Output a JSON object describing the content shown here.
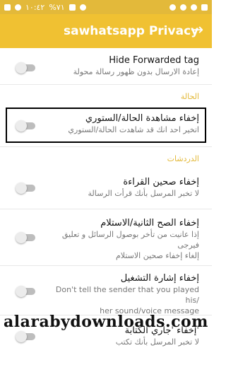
{
  "status_bar": {
    "time": "١٠:٤٢",
    "battery": "%٧١",
    "icons": [
      "sim-icon",
      "signal-icon",
      "wifi-icon",
      "battery-icon",
      "whatsapp-icon",
      "gear-icon",
      "circle-icon",
      "no-sim-icon"
    ]
  },
  "app_bar": {
    "title": "sawhatsapp Privacy",
    "back_icon": "arrow-right-icon",
    "back_glyph": "→"
  },
  "rows": [
    {
      "title": "Hide Forwarded tag",
      "subtitle": "إعادة الارسال بدون ظهور رسالة محولة",
      "enabled": false
    },
    {
      "title": "إخفاء مشاهدة الحالة/الستوري",
      "subtitle": "اتخير احد انك قد شاهدت الحالة/الستوري",
      "enabled": false
    },
    {
      "title": "إخفاء صحين القراءة",
      "subtitle": "لا تخبر المرسل بأنك قرأت الرسالة",
      "enabled": false
    },
    {
      "title": "إخفاء الصح الثانية/الاستلام",
      "subtitle_line1": "إذا عانيت من تأخر بوصول الرسائل و تعليق فيرجى",
      "subtitle_line2": "إلغاء إخفاء صحين الاستلام",
      "enabled": false
    },
    {
      "title": "إخفاء إشارة التشغيل",
      "subtitle_line1": "Don't tell the sender that you played his/",
      "subtitle_line2": "her sound/voice message",
      "enabled": false
    },
    {
      "title": "إخفاء 'جاري الكتابة'",
      "subtitle": "لا تخبر المرسل بأنك تكتب",
      "enabled": false
    }
  ],
  "sections": {
    "status": "الحالة",
    "chats": "الدردشات"
  },
  "watermark": "alarabydownloads.com",
  "colors": {
    "accent": "#f0c132",
    "status_bar": "#e3b93a",
    "section_text": "#e3b93a"
  }
}
